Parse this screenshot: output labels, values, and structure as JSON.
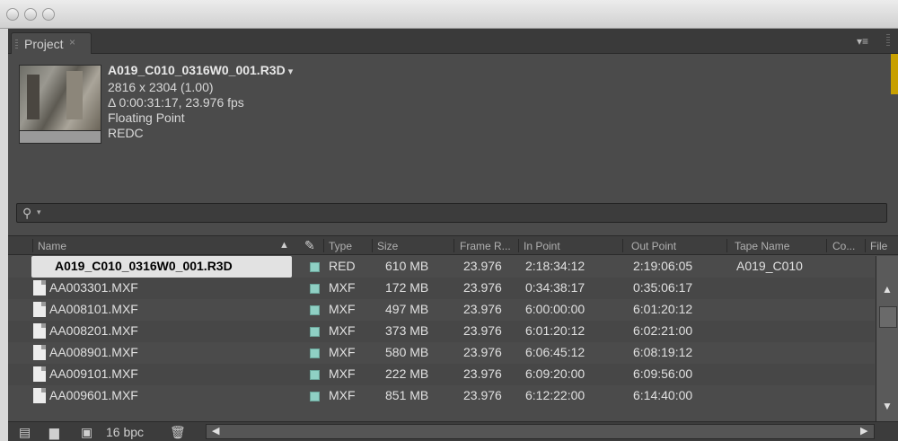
{
  "panel": {
    "tab_label": "Project",
    "tab_close": "×",
    "menu_icon": "panel-menu-icon"
  },
  "selected_item": {
    "name": "A019_C010_0316W0_001.R3D",
    "dropdown": "▾",
    "resolution": "2816 x 2304 (1.00)",
    "duration": "Δ 0:00:31:17, 23.976 fps",
    "depth": "Floating Point",
    "codec": "REDC"
  },
  "search": {
    "icon": "search-icon",
    "value": ""
  },
  "columns": {
    "name": "Name",
    "type": "Type",
    "size": "Size",
    "frame_rate": "Frame R...",
    "in_point": "In Point",
    "out_point": "Out Point",
    "tape_name": "Tape Name",
    "comment": "Co...",
    "file": "File"
  },
  "rows": [
    {
      "name": "A019_C010_0316W0_001.R3D",
      "type": "RED",
      "size": "610 MB",
      "fps": "23.976",
      "in": "2:18:34:12",
      "out": "2:19:06:05",
      "tape": "A019_C010",
      "selected": true
    },
    {
      "name": "AA003301.MXF",
      "type": "MXF",
      "size": "172 MB",
      "fps": "23.976",
      "in": "0:34:38:17",
      "out": "0:35:06:17",
      "tape": ""
    },
    {
      "name": "AA008101.MXF",
      "type": "MXF",
      "size": "497 MB",
      "fps": "23.976",
      "in": "6:00:00:00",
      "out": "6:01:20:12",
      "tape": ""
    },
    {
      "name": "AA008201.MXF",
      "type": "MXF",
      "size": "373 MB",
      "fps": "23.976",
      "in": "6:01:20:12",
      "out": "6:02:21:00",
      "tape": ""
    },
    {
      "name": "AA008901.MXF",
      "type": "MXF",
      "size": "580 MB",
      "fps": "23.976",
      "in": "6:06:45:12",
      "out": "6:08:19:12",
      "tape": ""
    },
    {
      "name": "AA009101.MXF",
      "type": "MXF",
      "size": "222 MB",
      "fps": "23.976",
      "in": "6:09:20:00",
      "out": "6:09:56:00",
      "tape": ""
    },
    {
      "name": "AA009601.MXF",
      "type": "MXF",
      "size": "851 MB",
      "fps": "23.976",
      "in": "6:12:22:00",
      "out": "6:14:40:00",
      "tape": ""
    }
  ],
  "footer": {
    "bpc": "16 bpc"
  },
  "colors": {
    "label_swatch": "#8fd0c4",
    "panel_bg": "#4b4b4b",
    "accent": "#c8a000"
  }
}
